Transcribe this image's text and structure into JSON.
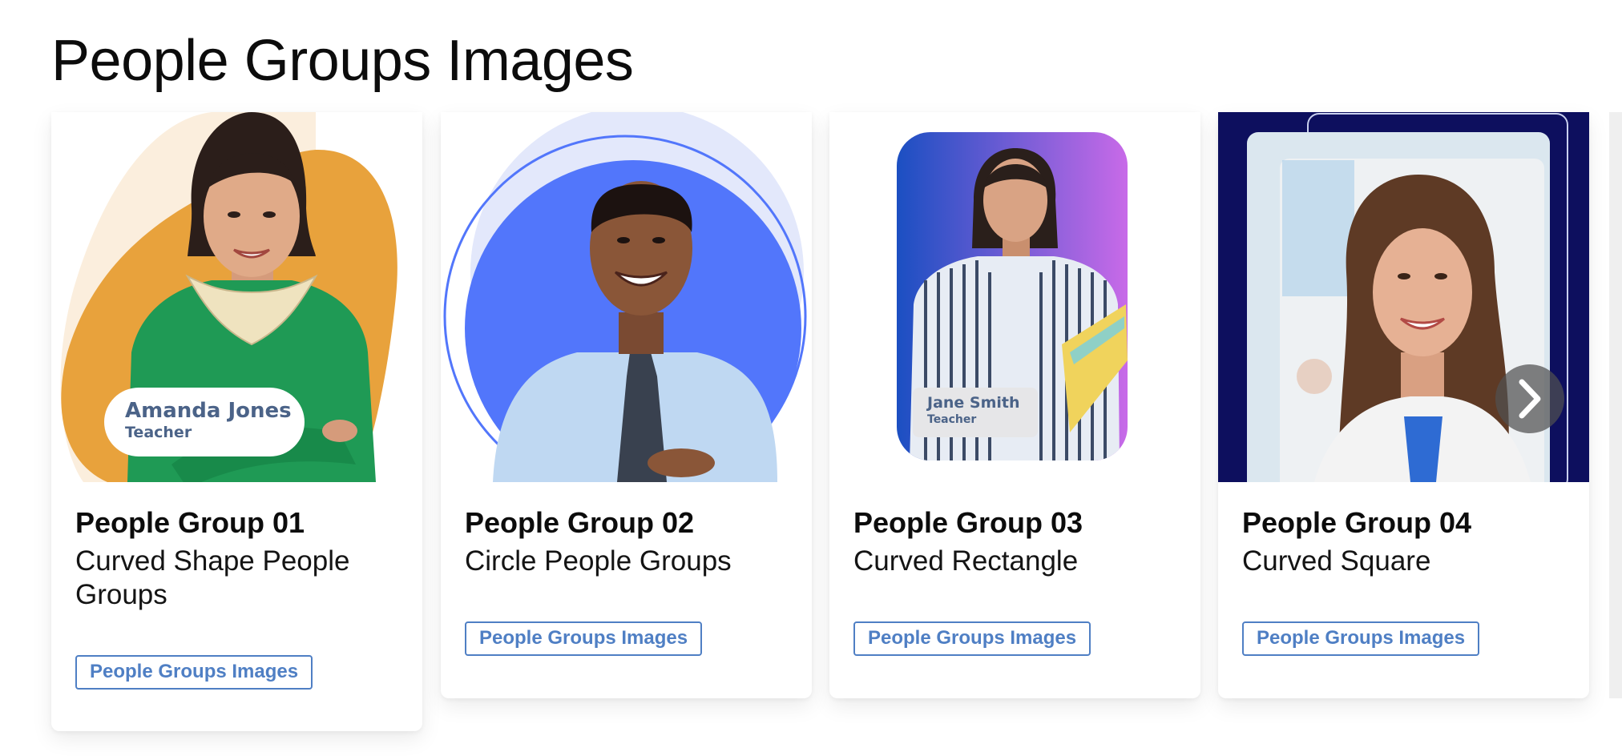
{
  "page": {
    "title": "People Groups Images"
  },
  "cards": [
    {
      "title": "People Group 01",
      "description": "Curved Shape People Groups",
      "tag": "People Groups Images",
      "badge": {
        "name": "Amanda Jones",
        "role": "Teacher"
      }
    },
    {
      "title": "People Group 02",
      "description": "Circle People Groups",
      "tag": "People Groups Images"
    },
    {
      "title": "People Group 03",
      "description": "Curved Rectangle",
      "tag": "People Groups Images",
      "badge": {
        "name": "Jane Smith",
        "role": "Teacher"
      }
    },
    {
      "title": "People Group 04",
      "description": "Curved Square",
      "tag": "People Groups Images"
    }
  ],
  "carousel": {
    "next_icon": "chevron-right-icon"
  },
  "colors": {
    "tag_blue": "#4f7fc4",
    "shape_orange": "#e8a23c",
    "shape_cream": "#fbeedd",
    "circle_blue": "#5276fb",
    "navy": "#0d0f5e",
    "gradient_start": "#1b4fc2",
    "gradient_end": "#c86ae8"
  }
}
